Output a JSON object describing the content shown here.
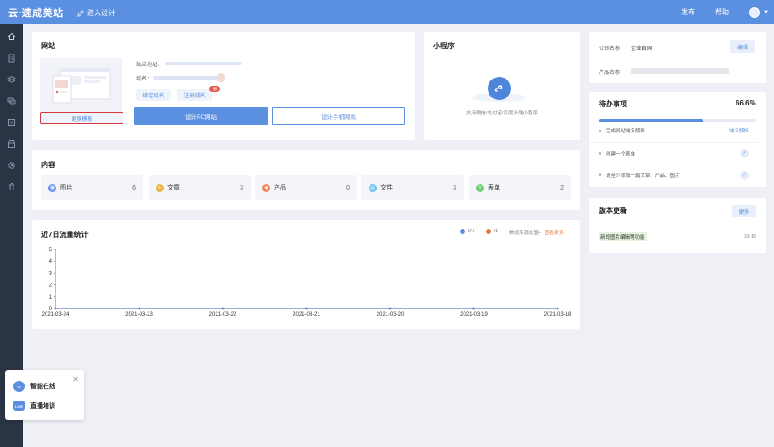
{
  "topbar": {
    "logo": "云·速成美站",
    "enter_design": "进入设计",
    "publish": "发布",
    "help": "帮助"
  },
  "website": {
    "title": "网站",
    "change_template": "更换模板",
    "site_address_label": "站点地址：",
    "domain_label": "域名：",
    "bind_domain": "绑定域名",
    "register_domain": "注册域名",
    "register_badge": "惠",
    "design_pc": "设计PC网站",
    "design_mobile": "设计手机网站"
  },
  "miniprogram": {
    "title": "小程序",
    "desc": "支持微信/支付宝/百度多端小程序"
  },
  "content": {
    "title": "内容",
    "tiles": [
      {
        "label": "图片",
        "count": "6",
        "color": "#6c8ff0"
      },
      {
        "label": "文章",
        "count": "3",
        "color": "#f0b43c"
      },
      {
        "label": "产品",
        "count": "0",
        "color": "#f0845a"
      },
      {
        "label": "文件",
        "count": "3",
        "color": "#6cc2f0"
      },
      {
        "label": "表单",
        "count": "2",
        "color": "#72cc7a"
      }
    ]
  },
  "traffic": {
    "title": "近7日流量统计",
    "legend_pv": "PV",
    "legend_ip": "IP",
    "source_text": "数据来源友盟+",
    "more": "查看更多"
  },
  "chart_data": {
    "type": "line",
    "categories": [
      "2021-03-24",
      "2021-03-23",
      "2021-03-22",
      "2021-03-21",
      "2021-03-20",
      "2021-03-19",
      "2021-03-18"
    ],
    "series": [
      {
        "name": "PV",
        "values": [
          0,
          0,
          0,
          0,
          0,
          0,
          0
        ],
        "color": "#5b8fe0"
      },
      {
        "name": "IP",
        "values": [
          0,
          0,
          0,
          0,
          0,
          0,
          0
        ],
        "color": "#e8773a"
      }
    ],
    "yticks": [
      "0",
      "1",
      "2",
      "3",
      "4",
      "5"
    ],
    "ylim": [
      0,
      5
    ],
    "grid": false,
    "legend_position": "top-right"
  },
  "company": {
    "company_label": "公司名称",
    "company_value": "企业官网",
    "edit": "编辑",
    "product_label": "产品名称"
  },
  "todo": {
    "title": "待办事项",
    "percent": "66.6%",
    "progress": 0.666,
    "items": [
      {
        "text": "完成网站域名解析",
        "action": "域名解析"
      },
      {
        "text": "创建一个表单"
      },
      {
        "text": "请至少添加一篇文章、产品、图片"
      }
    ]
  },
  "updates": {
    "title": "版本更新",
    "more": "更多",
    "item_text": "新增图片编辑等功能",
    "item_date": "03-19"
  },
  "float_widget": {
    "smart_online": "智能在线",
    "live_training": "直播培训",
    "live_icon_text": "LIVE"
  },
  "colors": {
    "primary": "#5b8fe0",
    "sidebar": "#2b3445",
    "highlight_border": "#d9363e"
  }
}
